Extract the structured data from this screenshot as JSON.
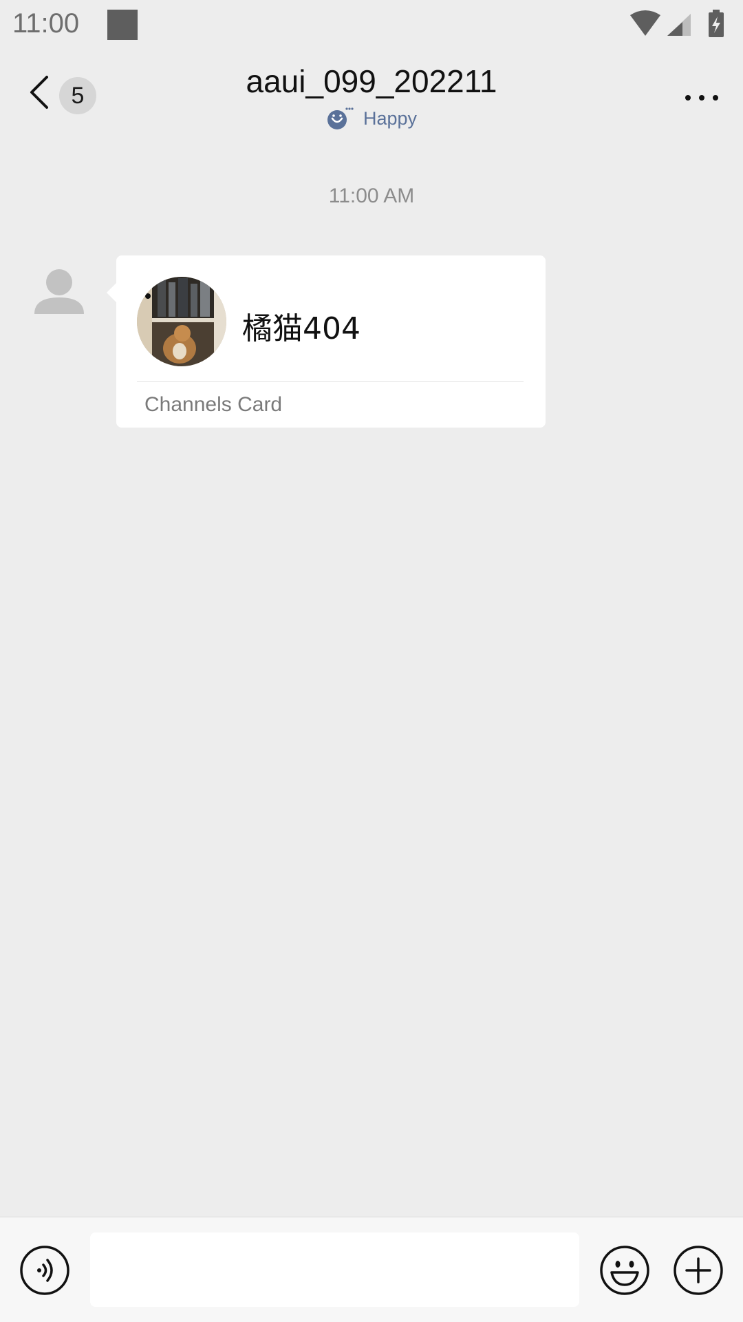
{
  "status_bar": {
    "time": "11:00",
    "icons": [
      "square-notification-icon",
      "wifi-icon",
      "cellular-signal-icon",
      "battery-charging-icon"
    ]
  },
  "nav": {
    "back_icon": "chevron-left-icon",
    "unread_count": "5",
    "title": "aaui_099_202211",
    "status_icon": "smiley-status-icon",
    "status_text": "Happy",
    "more_icon": "more-dots-icon"
  },
  "chat": {
    "timestamp": "11:00 AM",
    "messages": [
      {
        "sender_avatar": "default-person-icon",
        "type": "channels_card",
        "card_name": "橘猫404",
        "card_label": "Channels Card"
      }
    ]
  },
  "input_bar": {
    "voice_icon": "voice-icon",
    "text_value": "",
    "emoji_icon": "emoji-icon",
    "plus_icon": "plus-icon"
  },
  "colors": {
    "background": "#EDEDED",
    "bubble": "#FFFFFF",
    "status_text": "#5A7199",
    "input_bar": "#F7F7F7"
  }
}
